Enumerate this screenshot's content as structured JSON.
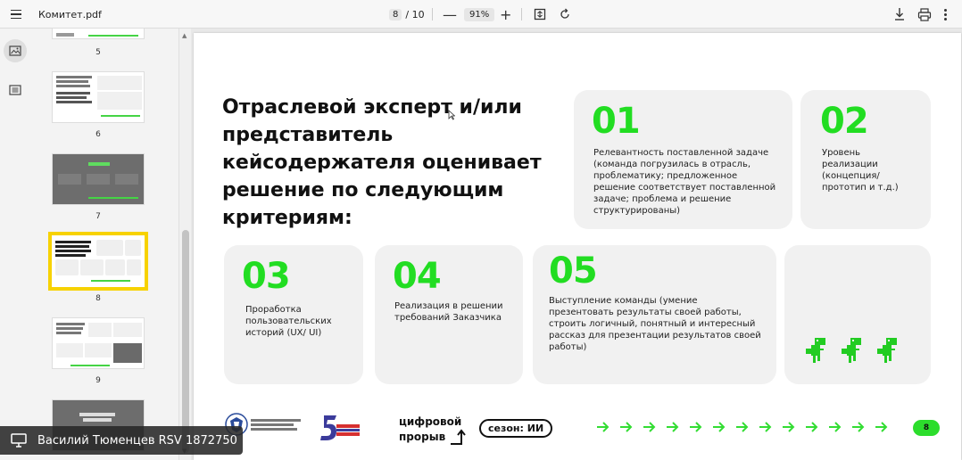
{
  "toolbar": {
    "file_name": "Комитет.pdf",
    "current_page": "8",
    "total_pages": "/ 10",
    "zoom": "91%",
    "zoom_out": "—",
    "zoom_in": "+"
  },
  "thumbnails": {
    "page_numbers": [
      "5",
      "6",
      "7",
      "8",
      "9"
    ],
    "selected": "8"
  },
  "slide": {
    "headline": "Отраслевой эксперт и/или представитель кейсодержателя оценивает решение по следующим критериям:",
    "criteria": [
      {
        "num": "01",
        "text": "Релевантность поставленной задаче (команда погрузилась в отрасль, проблематику; предложенное решение соответствует поставленной задаче; проблема и решение структурированы)"
      },
      {
        "num": "02",
        "text": "Уровень реализации (концепция/ прототип и т.д.)"
      },
      {
        "num": "03",
        "text": "Проработка пользовательских историй (UX/ UI)"
      },
      {
        "num": "04",
        "text": "Реализация в решении требований Заказчика"
      },
      {
        "num": "05",
        "text": "Выступление команды (умение презентовать результаты своей работы, строить логичный, понятный и интересный рассказ для презентации результатов своей работы)"
      }
    ],
    "footer": {
      "cifrovoy": "цифровой",
      "proryv": "прорыв",
      "season": "сезон: ИИ",
      "page_pill": "8"
    }
  },
  "user_bar": {
    "name": "Василий Тюменцев RSV 1872750"
  },
  "colors": {
    "accent_green": "#22dd22",
    "selected_outline": "#f7d200"
  }
}
